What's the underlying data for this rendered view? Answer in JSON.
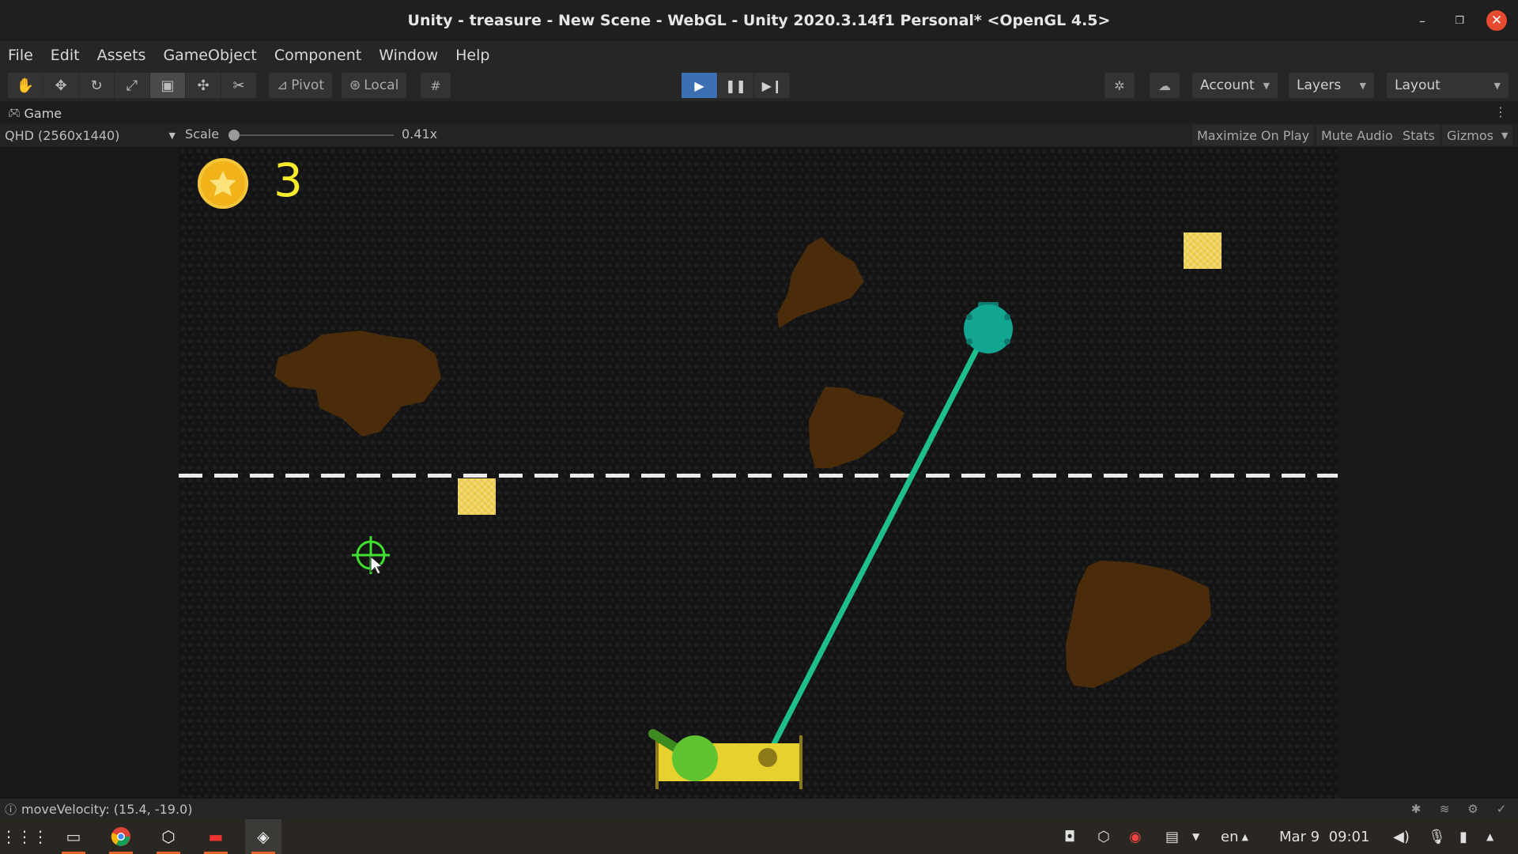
{
  "window": {
    "title": "Unity - treasure - New Scene - WebGL - Unity 2020.3.14f1 Personal* <OpenGL 4.5>"
  },
  "menu": [
    "File",
    "Edit",
    "Assets",
    "GameObject",
    "Component",
    "Window",
    "Help"
  ],
  "toolbar": {
    "tools": [
      "hand-tool",
      "move-tool",
      "rotate-tool",
      "scale-tool",
      "rect-tool",
      "transform-tool",
      "custom-tool"
    ],
    "active_tool": "rect-tool",
    "pivot_label": "Pivot",
    "local_label": "Local",
    "play_state": "playing",
    "account_label": "Account",
    "layers_label": "Layers",
    "layout_label": "Layout"
  },
  "game_panel": {
    "tab_label": "Game",
    "resolution": "QHD (2560x1440)",
    "scale_label": "Scale",
    "scale_value": "0.41x",
    "scale_fraction": 0.02,
    "buttons": [
      "Maximize On Play",
      "Mute Audio",
      "Stats",
      "Gizmos"
    ]
  },
  "game": {
    "coin_count": "3",
    "colors": {
      "rope": "#1ebf8c",
      "hook": "#12a591",
      "rock": "#4a2c0a",
      "treasure": "#f2d351",
      "coin": "#f2b31a",
      "cannon": "#5fc42f",
      "platform": "#e6d12e",
      "crosshair": "#3ee22f"
    }
  },
  "status": {
    "message": "moveVelocity: (15.4, -19.0)"
  },
  "taskbar": {
    "language": "en",
    "datetime": "Mar 9  09:01",
    "apps": [
      "files",
      "chrome",
      "unity-hub",
      "terminal",
      "unity-editor"
    ]
  }
}
